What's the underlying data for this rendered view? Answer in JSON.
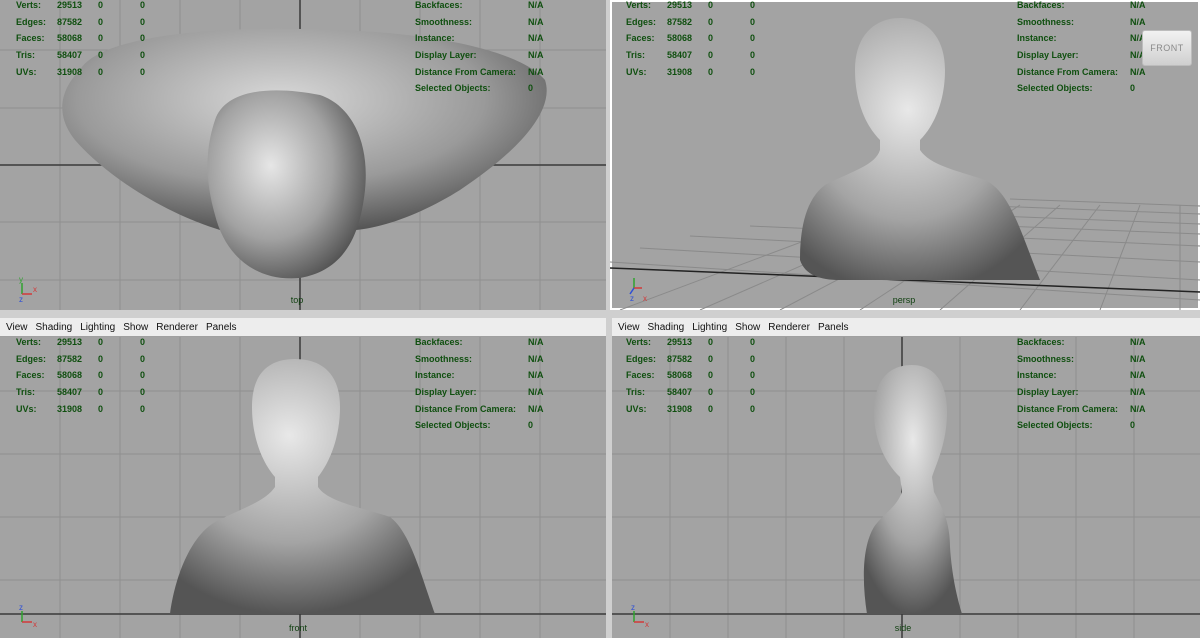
{
  "menu": [
    "View",
    "Shading",
    "Lighting",
    "Show",
    "Renderer",
    "Panels"
  ],
  "hud": {
    "left": [
      {
        "label": "Verts:",
        "v1": "29513",
        "v2": "0",
        "v3": "0"
      },
      {
        "label": "Edges:",
        "v1": "87582",
        "v2": "0",
        "v3": "0"
      },
      {
        "label": "Faces:",
        "v1": "58068",
        "v2": "0",
        "v3": "0"
      },
      {
        "label": "Tris:",
        "v1": "58407",
        "v2": "0",
        "v3": "0"
      },
      {
        "label": "UVs:",
        "v1": "31908",
        "v2": "0",
        "v3": "0"
      }
    ],
    "right": [
      {
        "label": "Backfaces:",
        "value": "N/A"
      },
      {
        "label": "Smoothness:",
        "value": "N/A"
      },
      {
        "label": "Instance:",
        "value": "N/A"
      },
      {
        "label": "Display Layer:",
        "value": "N/A"
      },
      {
        "label": "Distance From Camera:",
        "value": "N/A"
      },
      {
        "label": "Selected Objects:",
        "value": "0"
      }
    ]
  },
  "panels": [
    {
      "camera": "top"
    },
    {
      "camera": "persp",
      "viewcube": "FRONT"
    },
    {
      "camera": "front"
    },
    {
      "camera": "side"
    }
  ],
  "axes": {
    "x": "x",
    "y": "y",
    "z": "z"
  },
  "colors": {
    "viewport_bg": "#a3a3a3",
    "hud_text": "#0f4f0f",
    "x_axis": "#d23a3a",
    "y_axis": "#2fa32f",
    "z_axis": "#2e4fd6"
  }
}
